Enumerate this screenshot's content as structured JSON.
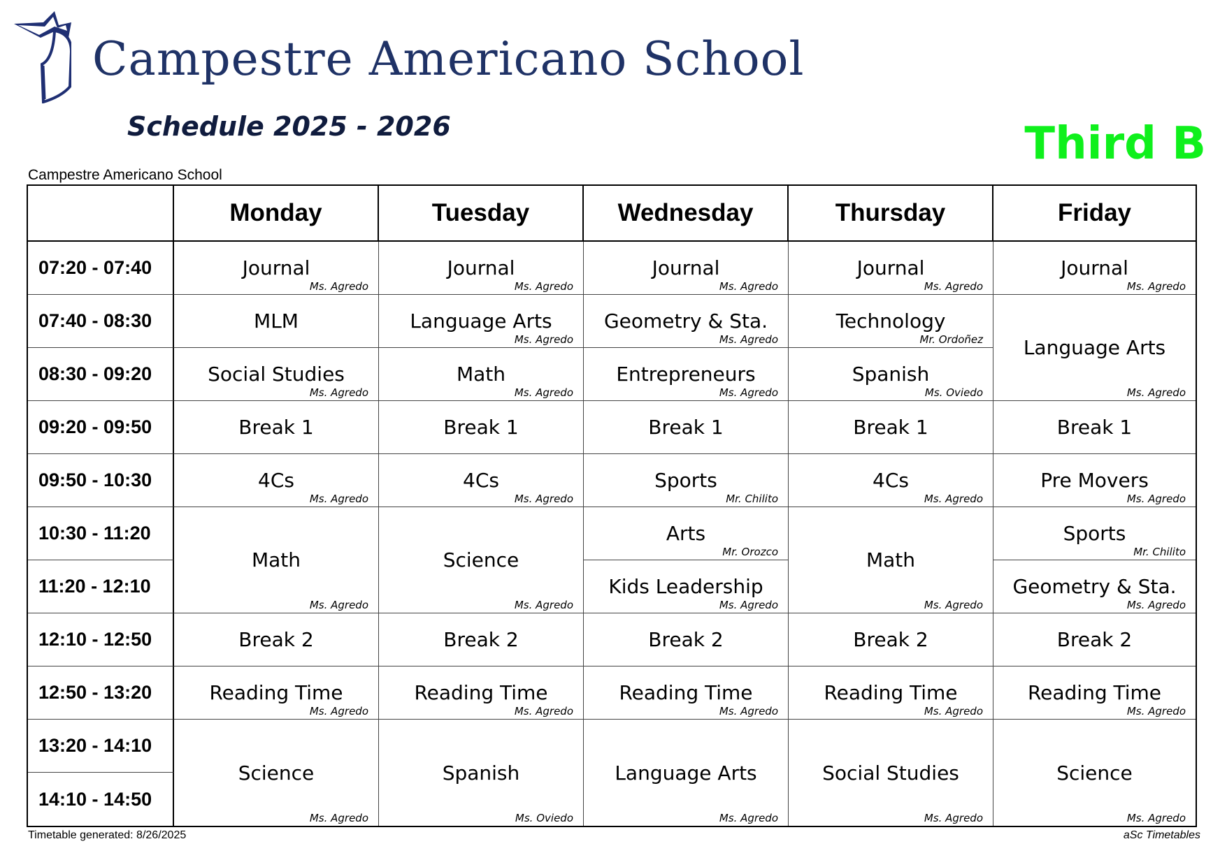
{
  "header": {
    "school_name": "Campestre Americano School",
    "schedule_title": "Schedule 2025 - 2026",
    "class_name": "Third B",
    "small_school_name": "Campestre Americano School"
  },
  "footer": {
    "generated": "Timetable generated: 8/26/2025",
    "credit": "aSc Timetables"
  },
  "colors": {
    "brand_navy": "#1f3266",
    "class_green": "#0ff01c"
  },
  "days": [
    "Monday",
    "Tuesday",
    "Wednesday",
    "Thursday",
    "Friday"
  ],
  "periods": [
    "07:20 - 07:40",
    "07:40 - 08:30",
    "08:30 - 09:20",
    "09:20 - 09:50",
    "09:50 - 10:30",
    "10:30 - 11:20",
    "11:20 - 12:10",
    "12:10 - 12:50",
    "12:50 - 13:20",
    "13:20 - 14:10",
    "14:10 - 14:50"
  ],
  "lessons": [
    {
      "day": 0,
      "start": 0,
      "span": 1,
      "subject": "Journal",
      "teacher": "Ms. Agredo"
    },
    {
      "day": 0,
      "start": 1,
      "span": 1,
      "subject": "MLM",
      "teacher": ""
    },
    {
      "day": 0,
      "start": 2,
      "span": 1,
      "subject": "Social Studies",
      "teacher": "Ms. Agredo"
    },
    {
      "day": 0,
      "start": 3,
      "span": 1,
      "subject": "Break 1",
      "teacher": ""
    },
    {
      "day": 0,
      "start": 4,
      "span": 1,
      "subject": "4Cs",
      "teacher": "Ms. Agredo"
    },
    {
      "day": 0,
      "start": 5,
      "span": 2,
      "subject": "Math",
      "teacher": "Ms. Agredo"
    },
    {
      "day": 0,
      "start": 7,
      "span": 1,
      "subject": "Break 2",
      "teacher": ""
    },
    {
      "day": 0,
      "start": 8,
      "span": 1,
      "subject": "Reading Time",
      "teacher": "Ms. Agredo"
    },
    {
      "day": 0,
      "start": 9,
      "span": 2,
      "subject": "Science",
      "teacher": "Ms. Agredo"
    },
    {
      "day": 1,
      "start": 0,
      "span": 1,
      "subject": "Journal",
      "teacher": "Ms. Agredo"
    },
    {
      "day": 1,
      "start": 1,
      "span": 1,
      "subject": "Language Arts",
      "teacher": "Ms. Agredo"
    },
    {
      "day": 1,
      "start": 2,
      "span": 1,
      "subject": "Math",
      "teacher": "Ms. Agredo"
    },
    {
      "day": 1,
      "start": 3,
      "span": 1,
      "subject": "Break 1",
      "teacher": ""
    },
    {
      "day": 1,
      "start": 4,
      "span": 1,
      "subject": "4Cs",
      "teacher": "Ms. Agredo"
    },
    {
      "day": 1,
      "start": 5,
      "span": 2,
      "subject": "Science",
      "teacher": "Ms. Agredo"
    },
    {
      "day": 1,
      "start": 7,
      "span": 1,
      "subject": "Break 2",
      "teacher": ""
    },
    {
      "day": 1,
      "start": 8,
      "span": 1,
      "subject": "Reading Time",
      "teacher": "Ms. Agredo"
    },
    {
      "day": 1,
      "start": 9,
      "span": 2,
      "subject": "Spanish",
      "teacher": "Ms. Oviedo"
    },
    {
      "day": 2,
      "start": 0,
      "span": 1,
      "subject": "Journal",
      "teacher": "Ms. Agredo"
    },
    {
      "day": 2,
      "start": 1,
      "span": 1,
      "subject": "Geometry & Sta.",
      "teacher": "Ms. Agredo"
    },
    {
      "day": 2,
      "start": 2,
      "span": 1,
      "subject": "Entrepreneurs",
      "teacher": "Ms. Agredo"
    },
    {
      "day": 2,
      "start": 3,
      "span": 1,
      "subject": "Break 1",
      "teacher": ""
    },
    {
      "day": 2,
      "start": 4,
      "span": 1,
      "subject": "Sports",
      "teacher": "Mr. Chilito"
    },
    {
      "day": 2,
      "start": 5,
      "span": 1,
      "subject": "Arts",
      "teacher": "Mr. Orozco"
    },
    {
      "day": 2,
      "start": 6,
      "span": 1,
      "subject": "Kids Leadership",
      "teacher": "Ms. Agredo"
    },
    {
      "day": 2,
      "start": 7,
      "span": 1,
      "subject": "Break 2",
      "teacher": ""
    },
    {
      "day": 2,
      "start": 8,
      "span": 1,
      "subject": "Reading Time",
      "teacher": "Ms. Agredo"
    },
    {
      "day": 2,
      "start": 9,
      "span": 2,
      "subject": "Language Arts",
      "teacher": "Ms. Agredo"
    },
    {
      "day": 3,
      "start": 0,
      "span": 1,
      "subject": "Journal",
      "teacher": "Ms. Agredo"
    },
    {
      "day": 3,
      "start": 1,
      "span": 1,
      "subject": "Technology",
      "teacher": "Mr. Ordoñez"
    },
    {
      "day": 3,
      "start": 2,
      "span": 1,
      "subject": "Spanish",
      "teacher": "Ms. Oviedo"
    },
    {
      "day": 3,
      "start": 3,
      "span": 1,
      "subject": "Break 1",
      "teacher": ""
    },
    {
      "day": 3,
      "start": 4,
      "span": 1,
      "subject": "4Cs",
      "teacher": "Ms. Agredo"
    },
    {
      "day": 3,
      "start": 5,
      "span": 2,
      "subject": "Math",
      "teacher": "Ms. Agredo"
    },
    {
      "day": 3,
      "start": 7,
      "span": 1,
      "subject": "Break 2",
      "teacher": ""
    },
    {
      "day": 3,
      "start": 8,
      "span": 1,
      "subject": "Reading Time",
      "teacher": "Ms. Agredo"
    },
    {
      "day": 3,
      "start": 9,
      "span": 2,
      "subject": "Social Studies",
      "teacher": "Ms. Agredo"
    },
    {
      "day": 4,
      "start": 0,
      "span": 1,
      "subject": "Journal",
      "teacher": "Ms. Agredo"
    },
    {
      "day": 4,
      "start": 1,
      "span": 2,
      "subject": "Language Arts",
      "teacher": "Ms. Agredo"
    },
    {
      "day": 4,
      "start": 3,
      "span": 1,
      "subject": "Break 1",
      "teacher": ""
    },
    {
      "day": 4,
      "start": 4,
      "span": 1,
      "subject": "Pre Movers",
      "teacher": "Ms. Agredo"
    },
    {
      "day": 4,
      "start": 5,
      "span": 1,
      "subject": "Sports",
      "teacher": "Mr. Chilito"
    },
    {
      "day": 4,
      "start": 6,
      "span": 1,
      "subject": "Geometry & Sta.",
      "teacher": "Ms. Agredo"
    },
    {
      "day": 4,
      "start": 7,
      "span": 1,
      "subject": "Break 2",
      "teacher": ""
    },
    {
      "day": 4,
      "start": 8,
      "span": 1,
      "subject": "Reading Time",
      "teacher": "Ms. Agredo"
    },
    {
      "day": 4,
      "start": 9,
      "span": 2,
      "subject": "Science",
      "teacher": "Ms. Agredo"
    }
  ]
}
